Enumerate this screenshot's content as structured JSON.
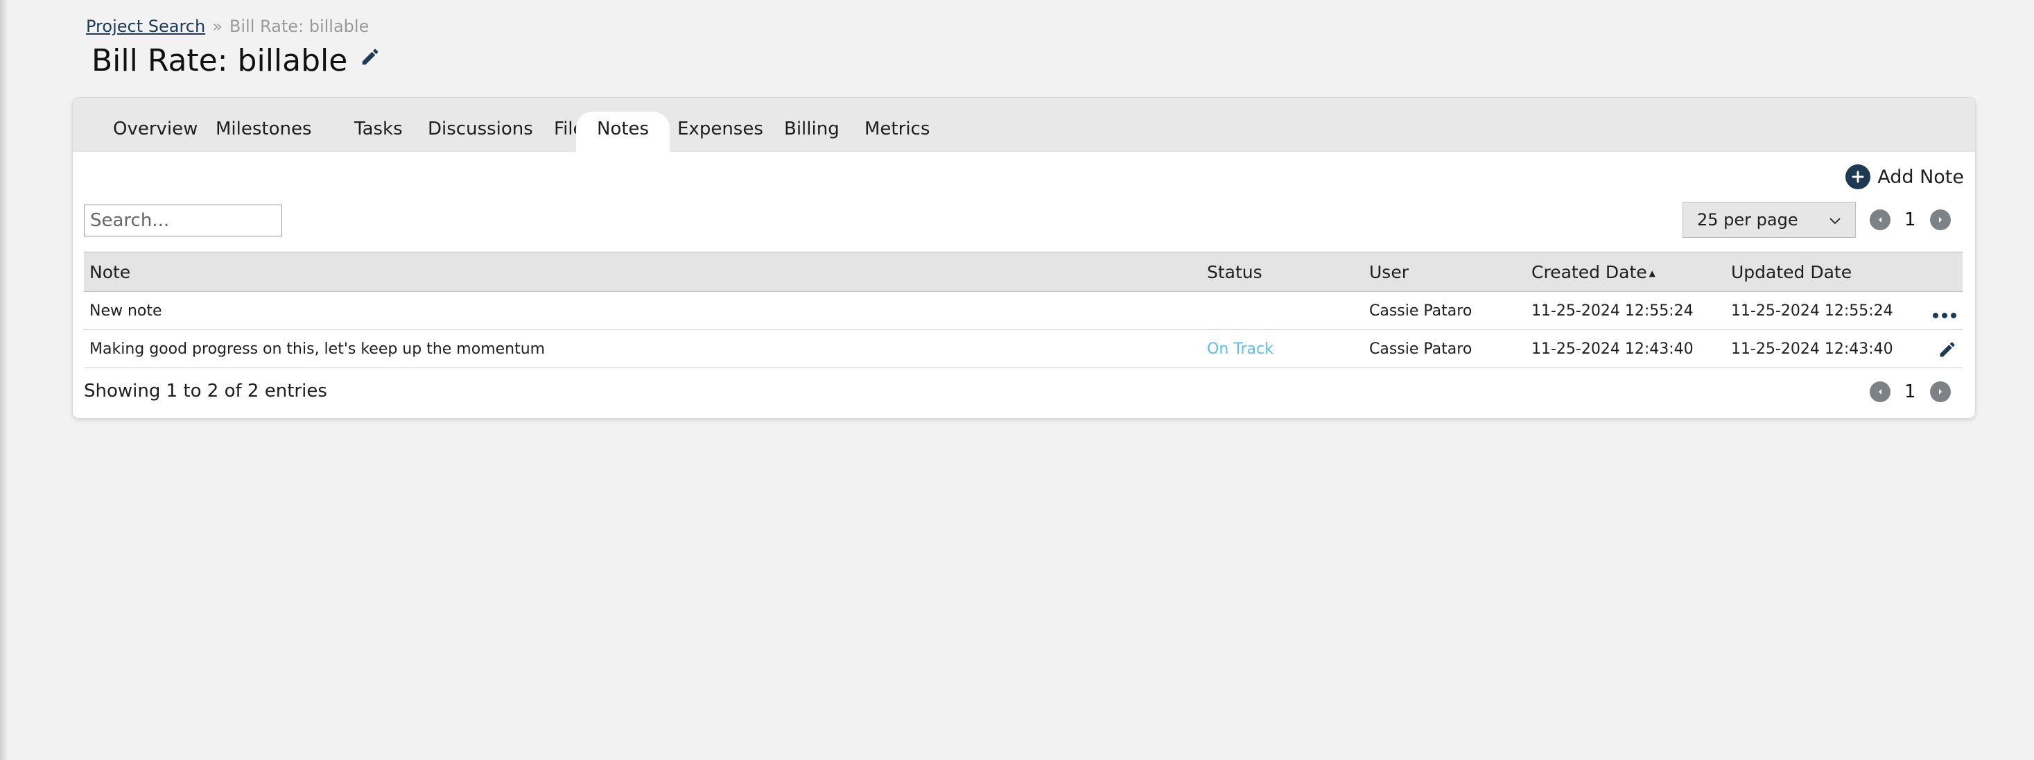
{
  "breadcrumb": {
    "link_label": "Project Search",
    "separator": "»",
    "current": "Bill Rate: billable"
  },
  "page": {
    "title": "Bill Rate: billable"
  },
  "tabs": [
    {
      "label": "Overview"
    },
    {
      "label": "Milestones"
    },
    {
      "label": "Tasks"
    },
    {
      "label": "Discussions"
    },
    {
      "label": "Files"
    },
    {
      "label": "Notes",
      "active": true
    },
    {
      "label": "Expenses"
    },
    {
      "label": "Billing"
    },
    {
      "label": "Metrics"
    }
  ],
  "toolbar": {
    "add_note_label": "Add Note",
    "search_placeholder": "Search...",
    "per_page_selected": "25 per page",
    "page_number": "1"
  },
  "table": {
    "columns": {
      "note": "Note",
      "status": "Status",
      "user": "User",
      "created": "Created Date",
      "updated": "Updated Date"
    },
    "rows": [
      {
        "note": "New note",
        "status": "",
        "user": "Cassie Pataro",
        "created": "11-25-2024 12:55:24",
        "updated": "11-25-2024 12:55:24",
        "action_icon": "more-icon"
      },
      {
        "note": "Making good progress on this, let's keep up the momentum",
        "status": "On Track",
        "user": "Cassie Pataro",
        "created": "11-25-2024 12:43:40",
        "updated": "11-25-2024 12:43:40",
        "action_icon": "pencil-icon"
      }
    ]
  },
  "footer": {
    "info": "Showing 1 to 2 of 2 entries",
    "page_number": "1"
  },
  "colors": {
    "brand_navy": "#1d3a55",
    "status_on_track": "#5bbfe0",
    "pager_gray": "#7d8286"
  }
}
